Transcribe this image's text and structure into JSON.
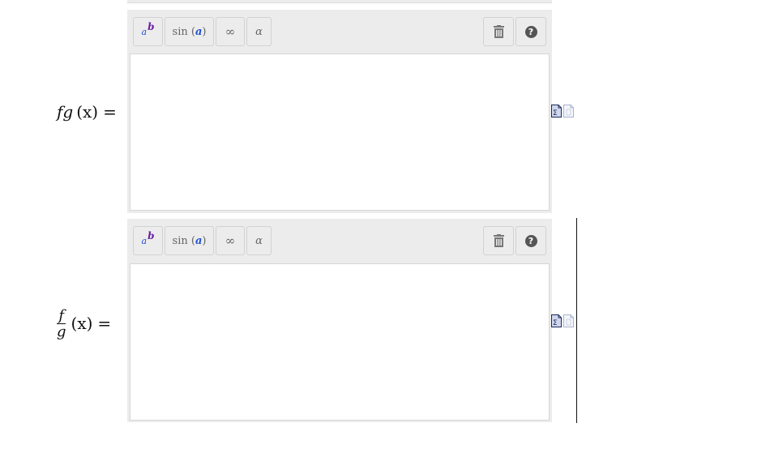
{
  "toolbar": {
    "power_base": "a",
    "power_exp": "b",
    "func_name": "sin",
    "func_arg": "a",
    "infinity": "∞",
    "alpha": "α",
    "help": "?"
  },
  "rows": [
    {
      "label_func": "fg",
      "label_var": "(x)",
      "label_eq": "="
    },
    {
      "label_num": "f",
      "label_den": "g",
      "label_var": "(x)",
      "label_eq": "="
    }
  ],
  "icons": {
    "trash": "trash-icon",
    "help": "help-icon",
    "formula_doc": "formula-doc-icon",
    "blank_doc": "document-icon"
  }
}
